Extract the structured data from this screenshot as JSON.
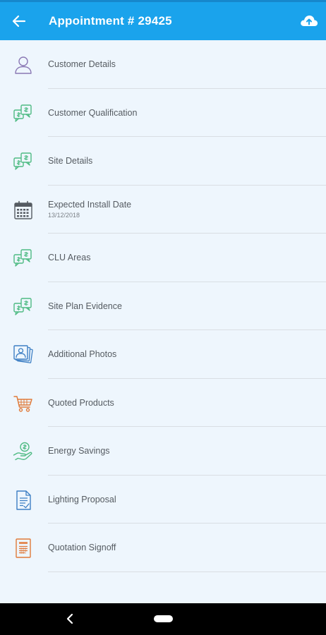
{
  "header": {
    "title": "Appointment # 29425",
    "back_icon": "arrow-left-icon",
    "upload_icon": "cloud-upload-icon"
  },
  "colors": {
    "appbar": "#1aa3ec",
    "background": "#eef6fd",
    "green": "#4fbb83",
    "purple": "#8a78b4",
    "blue": "#3d7fc4",
    "orange": "#e07a3a"
  },
  "items": [
    {
      "label": "Customer Details",
      "sublabel": "",
      "icon": "user-icon"
    },
    {
      "label": "Customer Qualification",
      "sublabel": "",
      "icon": "chat-bubbles-icon"
    },
    {
      "label": "Site Details",
      "sublabel": "",
      "icon": "chat-bubbles-icon"
    },
    {
      "label": "Expected Install Date",
      "sublabel": "13/12/2018",
      "icon": "calendar-icon"
    },
    {
      "label": "CLU Areas",
      "sublabel": "",
      "icon": "chat-bubbles-icon"
    },
    {
      "label": "Site Plan Evidence",
      "sublabel": "",
      "icon": "chat-bubbles-icon"
    },
    {
      "label": "Additional Photos",
      "sublabel": "",
      "icon": "photos-icon"
    },
    {
      "label": "Quoted Products",
      "sublabel": "",
      "icon": "cart-icon"
    },
    {
      "label": "Energy Savings",
      "sublabel": "",
      "icon": "savings-hand-icon"
    },
    {
      "label": "Lighting Proposal",
      "sublabel": "",
      "icon": "document-icon"
    },
    {
      "label": "Quotation Signoff",
      "sublabel": "",
      "icon": "signoff-document-icon"
    }
  ]
}
